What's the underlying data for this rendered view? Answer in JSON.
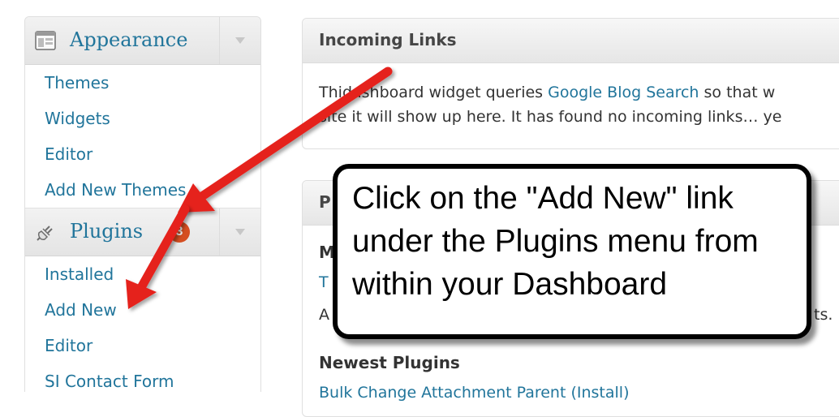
{
  "sidebar": {
    "appearance": {
      "title": "Appearance",
      "items": [
        "Themes",
        "Widgets",
        "Editor",
        "Add New Themes"
      ]
    },
    "plugins": {
      "title": "Plugins",
      "badge": "3",
      "items": [
        "Installed",
        "Add New",
        "Editor",
        "SI Contact Form"
      ]
    }
  },
  "incoming_links": {
    "title": "Incoming Links",
    "line1_pre": "Thi",
    "line1_mid": "dashboard widget queries ",
    "line1_link": "Google Blog Search",
    "line1_post": " so that w",
    "line2": "site it will show up here. It has found no incoming links… ye"
  },
  "plugins_widget": {
    "title_partial": "P",
    "line_m": "M",
    "line_t": "T",
    "line_a": "A",
    "line_ts": "ts.",
    "newest_heading": "Newest Plugins",
    "newest_link": "Bulk Change Attachment Parent (Install)"
  },
  "callout": {
    "text": "Click on the \"Add New\" link under the Plugins menu from within your Dashboard"
  },
  "colors": {
    "link": "#21759b",
    "badge": "#d54e21",
    "arrow": "#e5201e"
  }
}
